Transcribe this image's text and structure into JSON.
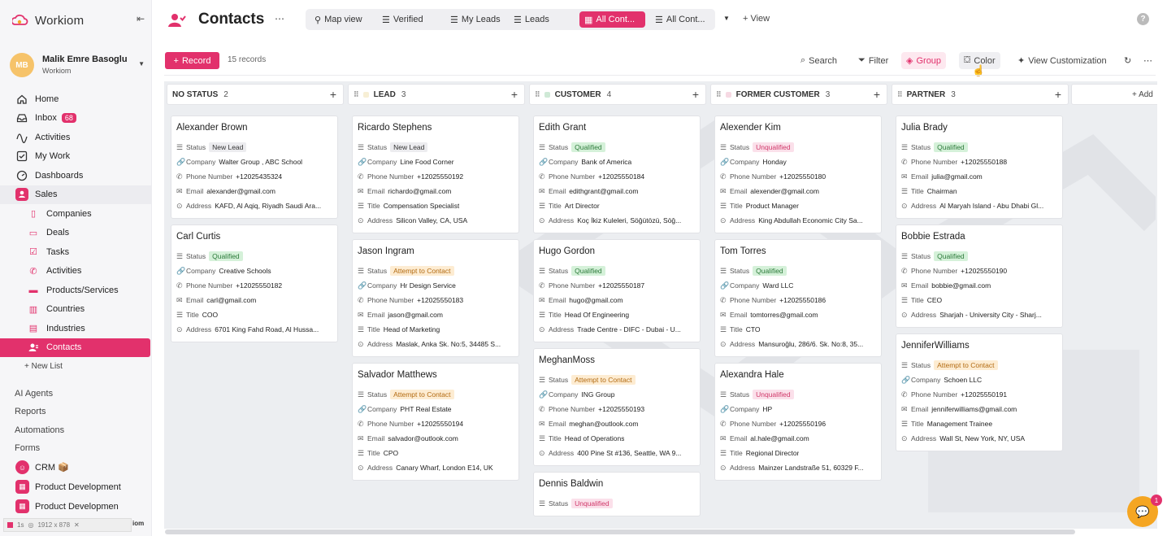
{
  "app": {
    "name": "Workiom"
  },
  "user": {
    "initials": "MB",
    "name": "Malik Emre Basoglu",
    "org": "Workiom"
  },
  "nav": {
    "home": "Home",
    "inbox": "Inbox",
    "inbox_count": "68",
    "activities": "Activities",
    "my_work": "My Work",
    "dashboards": "Dashboards",
    "sales": "Sales",
    "sub": [
      "Companies",
      "Deals",
      "Tasks",
      "Activities",
      "Products/Services",
      "Countries",
      "Industries",
      "Contacts"
    ],
    "new_list": "+ New List",
    "ai_agents": "AI Agents",
    "reports": "Reports",
    "automations": "Automations",
    "forms": "Forms",
    "spaces": [
      "CRM 📦",
      "Product Development",
      "Product Developmen"
    ]
  },
  "devbar": {
    "time": "1s",
    "size": "1912 x 878",
    "tag": "iom"
  },
  "header": {
    "title": "Contacts",
    "tabs": [
      "Map view",
      "Verified",
      "My Leads",
      "Leads",
      "All Cont...",
      "All Cont..."
    ],
    "active_tab": "All Cont...",
    "add_view": "+ View"
  },
  "toolbar": {
    "record": "Record",
    "count": "15 records",
    "search": "Search",
    "filter": "Filter",
    "group": "Group",
    "color": "Color",
    "view_customization": "View Customization"
  },
  "labels": {
    "status": "Status",
    "company": "Company",
    "phone": "Phone Number",
    "email": "Email",
    "title": "Title",
    "address": "Address"
  },
  "columns": [
    {
      "name": "NO STATUS",
      "count": "2",
      "color": "",
      "cards": [
        {
          "name": "Alexander Brown",
          "status": "New Lead",
          "status_type": "new",
          "fields": [
            [
              "company",
              "Walter Group , ABC School"
            ],
            [
              "phone",
              "+12025435324"
            ],
            [
              "email",
              "alexander@gmail.com"
            ],
            [
              "address",
              "KAFD, Al Aqiq, Riyadh Saudi Ara..."
            ]
          ]
        },
        {
          "name": "Carl Curtis",
          "status": "Qualified",
          "status_type": "qual",
          "fields": [
            [
              "company",
              "Creative Schools"
            ],
            [
              "phone",
              "+12025550182"
            ],
            [
              "email",
              "carl@gmail.com"
            ],
            [
              "title",
              "COO"
            ],
            [
              "address",
              "6701 King Fahd Road, Al Hussa..."
            ]
          ]
        }
      ]
    },
    {
      "name": "LEAD",
      "count": "3",
      "color": "#f7efd5",
      "cards": [
        {
          "name": "Ricardo Stephens",
          "status": "New Lead",
          "status_type": "new",
          "fields": [
            [
              "company",
              "Line Food Corner"
            ],
            [
              "phone",
              "+12025550192"
            ],
            [
              "email",
              "richardo@gmail.com"
            ],
            [
              "title",
              "Compensation Specialist"
            ],
            [
              "address",
              "Silicon Valley, CA, USA"
            ]
          ]
        },
        {
          "name": "Jason Ingram",
          "status": "Attempt to Contact",
          "status_type": "att",
          "fields": [
            [
              "company",
              "Hr Design Service"
            ],
            [
              "phone",
              "+12025550183"
            ],
            [
              "email",
              "jason@gmail.com"
            ],
            [
              "title",
              "Head of Marketing"
            ],
            [
              "address",
              "Maslak, Anka Sk. No:5, 34485 S..."
            ]
          ]
        },
        {
          "name": "Salvador Matthews",
          "status": "Attempt to Contact",
          "status_type": "att",
          "fields": [
            [
              "company",
              "PHT Real Estate"
            ],
            [
              "phone",
              "+12025550194"
            ],
            [
              "email",
              "salvador@outlook.com"
            ],
            [
              "title",
              "CPO"
            ],
            [
              "address",
              "Canary Wharf, London E14, UK"
            ]
          ]
        }
      ]
    },
    {
      "name": "CUSTOMER",
      "count": "4",
      "color": "#cfe9d6",
      "cards": [
        {
          "name": "Edith Grant",
          "status": "Qualified",
          "status_type": "qual",
          "fields": [
            [
              "company",
              "Bank of America"
            ],
            [
              "phone",
              "+12025550184"
            ],
            [
              "email",
              "edithgrant@gmail.com"
            ],
            [
              "title",
              "Art Director"
            ],
            [
              "address",
              "Koç İkiz Kuleleri, Söğütözü, Söğ..."
            ]
          ]
        },
        {
          "name": "Hugo Gordon",
          "status": "Qualified",
          "status_type": "qual",
          "fields": [
            [
              "phone",
              "+12025550187"
            ],
            [
              "email",
              "hugo@gmail.com"
            ],
            [
              "title",
              "Head Of Engineering"
            ],
            [
              "address",
              "Trade Centre - DIFC - Dubai - U..."
            ]
          ]
        },
        {
          "name": "MeghanMoss",
          "status": "Attempt to Contact",
          "status_type": "att",
          "fields": [
            [
              "company",
              "ING Group"
            ],
            [
              "phone",
              "+12025550193"
            ],
            [
              "email",
              "meghan@outlook.com"
            ],
            [
              "title",
              "Head of Operations"
            ],
            [
              "address",
              "400 Pine St #136, Seattle, WA 9..."
            ]
          ]
        },
        {
          "name": "Dennis Baldwin",
          "status": "Unqualified",
          "status_type": "unq",
          "fields": []
        }
      ]
    },
    {
      "name": "FORMER CUSTOMER",
      "count": "3",
      "color": "#f6d9e3",
      "cards": [
        {
          "name": "Alexender Kim",
          "status": "Unqualified",
          "status_type": "unq",
          "fields": [
            [
              "company",
              "Honday"
            ],
            [
              "phone",
              "+12025550180"
            ],
            [
              "email",
              "alexender@gmail.com"
            ],
            [
              "title",
              "Product Manager"
            ],
            [
              "address",
              "King Abdullah Economic City Sa..."
            ]
          ]
        },
        {
          "name": "Tom Torres",
          "status": "Qualified",
          "status_type": "qual",
          "fields": [
            [
              "company",
              "Ward LLC"
            ],
            [
              "phone",
              "+12025550186"
            ],
            [
              "email",
              "tomtorres@gmail.com"
            ],
            [
              "title",
              "CTO"
            ],
            [
              "address",
              "Mansuroğlu, 286/6. Sk. No:8, 35..."
            ]
          ]
        },
        {
          "name": "Alexandra Hale",
          "status": "Unqualified",
          "status_type": "unq",
          "fields": [
            [
              "company",
              "HP"
            ],
            [
              "phone",
              "+12025550196"
            ],
            [
              "email",
              "al.hale@gmail.com"
            ],
            [
              "title",
              "Regional Director"
            ],
            [
              "address",
              "Mainzer Landstraße 51, 60329 F..."
            ]
          ]
        }
      ]
    },
    {
      "name": "PARTNER",
      "count": "3",
      "color": "",
      "cards": [
        {
          "name": "Julia Brady",
          "status": "Qualified",
          "status_type": "qual",
          "fields": [
            [
              "phone",
              "+12025550188"
            ],
            [
              "email",
              "julia@gmail.com"
            ],
            [
              "title",
              "Chairman"
            ],
            [
              "address",
              "Al Maryah Island - Abu Dhabi Gl..."
            ]
          ]
        },
        {
          "name": "Bobbie Estrada",
          "status": "Qualified",
          "status_type": "qual",
          "fields": [
            [
              "phone",
              "+12025550190"
            ],
            [
              "email",
              "bobbie@gmail.com"
            ],
            [
              "title",
              "CEO"
            ],
            [
              "address",
              "Sharjah - University City - Sharj..."
            ]
          ]
        },
        {
          "name": "JenniferWilliams",
          "status": "Attempt to Contact",
          "status_type": "att",
          "fields": [
            [
              "company",
              "Schoen LLC"
            ],
            [
              "phone",
              "+12025550191"
            ],
            [
              "email",
              "jenniferwilliams@gmail.com"
            ],
            [
              "title",
              "Management Trainee"
            ],
            [
              "address",
              "Wall St, New York, NY, USA"
            ]
          ]
        }
      ]
    }
  ],
  "add_group": "+ Add",
  "chat_badge": "1",
  "colors": {
    "accent": "#e2316c",
    "chat": "#f5a623"
  }
}
